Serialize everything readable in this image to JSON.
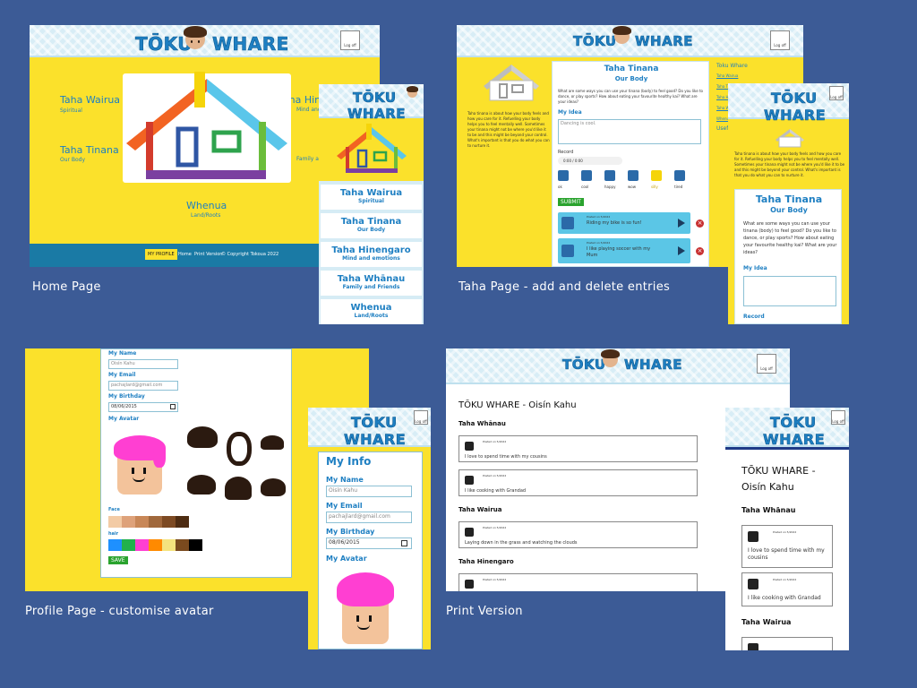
{
  "app": {
    "logo_left": "TŌKU",
    "logo_right": "WHARE",
    "logo_mobile_top": "TŌKU",
    "logo_mobile_bottom": "WHARE",
    "logoff": "Log off"
  },
  "captions": {
    "home": "Home Page",
    "taha": "Taha Page - add and delete entries",
    "profile": "Profile Page - customise avatar",
    "print": "Print Version"
  },
  "home": {
    "taha_wairua": "Taha Wairua",
    "taha_wairua_sub": "Spiritual",
    "taha_tinana": "Taha Tinana",
    "taha_tinana_sub": "Our Body",
    "taha_hin": "Taha Hin",
    "taha_hin_sub": "Mind and",
    "family_sub": "Family a",
    "whenua": "Whenua",
    "whenua_sub": "Land/Roots",
    "footer": {
      "profile": "MY PROFILE",
      "home": "Home",
      "print": "Print Version",
      "copyright": "© Copyright Tokoua 2022"
    }
  },
  "home_mobile": {
    "items": [
      {
        "title": "Taha Wairua",
        "sub": "Spiritual"
      },
      {
        "title": "Taha Tinana",
        "sub": "Our Body"
      },
      {
        "title": "Taha Hinengaro",
        "sub": "Mind and emotions"
      },
      {
        "title": "Taha Whānau",
        "sub": "Family and Friends"
      },
      {
        "title": "Whenua",
        "sub": "Land/Roots"
      }
    ]
  },
  "taha": {
    "title": "Taha Tinana",
    "sub": "Our Body",
    "question": "What are some ways you can use your tinana (body) to feel good? Do you like to dance, or play sports? How about eating your favourite healthy kai? What are your ideas?",
    "intro": "Taha tinana is about how your body feels and how you care for it. Refuelling your body helps you to feel mentally well. Sometimes your tinana might not be where you'd like it to be and this might be beyond your control. What's important is that you do what you can to nurture it.",
    "my_idea": "My Idea",
    "idea_value": "Dancing is cool.",
    "record": "Record",
    "audio_time": "0:00 / 0:00",
    "moods": [
      "ok",
      "cool",
      "happy",
      "wow",
      "silly",
      "tired"
    ],
    "submit": "SUBMIT",
    "entries": [
      {
        "posted": "Posted on 5/2022",
        "text": "Riding my bike is so fun!"
      },
      {
        "posted": "Posted on 5/2022",
        "text": "I like playing soccer with my Mum"
      }
    ],
    "sidebar_title": "Toku Whare",
    "sidebar_links": [
      "Taha Wairua",
      "Taha Tinana",
      "Taha Hinengaro",
      "Taha Whānau",
      "Whenua"
    ],
    "useful": "Usef",
    "mobile_title": "Taha Tinana",
    "mobile_sub": "Our Body",
    "mobile_my_idea": "My Idea",
    "mobile_record": "Record"
  },
  "profile": {
    "my_name": "My Name",
    "name_value": "Oisín Kahu",
    "my_email": "My Email",
    "email_value": "pachajlard@gmail.com",
    "my_birthday": "My Birthday",
    "birthday_value": "08/06/2015",
    "my_avatar": "My Avatar",
    "face": "Face",
    "hair": "hair",
    "save": "SAVE",
    "mobile_title": "My Info",
    "face_colors": [
      "#f3cba5",
      "#dea27a",
      "#c88757",
      "#a0683c",
      "#7d4a23",
      "#4e2c12"
    ],
    "hair_colors": [
      "#1e90ff",
      "#22b14c",
      "#ff3fd2",
      "#ff8a00",
      "#f4e37e",
      "#7a4a1e",
      "#000000"
    ]
  },
  "print": {
    "title": "TŌKU WHARE - Oisín Kahu",
    "mobile_title_1": "TŌKU WHARE -",
    "mobile_title_2": "Oisín Kahu",
    "sections": [
      {
        "name": "Taha Whānau",
        "entries": [
          {
            "posted": "Posted on 5/2022",
            "text": "I love to spend time with my cousins"
          },
          {
            "posted": "Posted on 5/2022",
            "text": "I like cooking with Grandad"
          }
        ]
      },
      {
        "name": "Taha Wairua",
        "entries": [
          {
            "posted": "Posted on 5/2022",
            "text": "Laying down in the grass and watching the clouds"
          }
        ]
      },
      {
        "name": "Taha Hinengaro",
        "entries": [
          {
            "posted": "Posted on 5/2022",
            "text": ""
          }
        ]
      }
    ],
    "mobile_entries": [
      {
        "posted": "Posted on 5/2022",
        "text": "I love to spend time with my cousins"
      },
      {
        "posted": "Posted on 5/2022",
        "text": "I like cooking with Grandad"
      }
    ]
  },
  "colors": {
    "background": "#3c5b96",
    "yellow": "#fbe12b",
    "brand_blue": "#1e7fc2",
    "footer_blue": "#1a7aa5"
  }
}
